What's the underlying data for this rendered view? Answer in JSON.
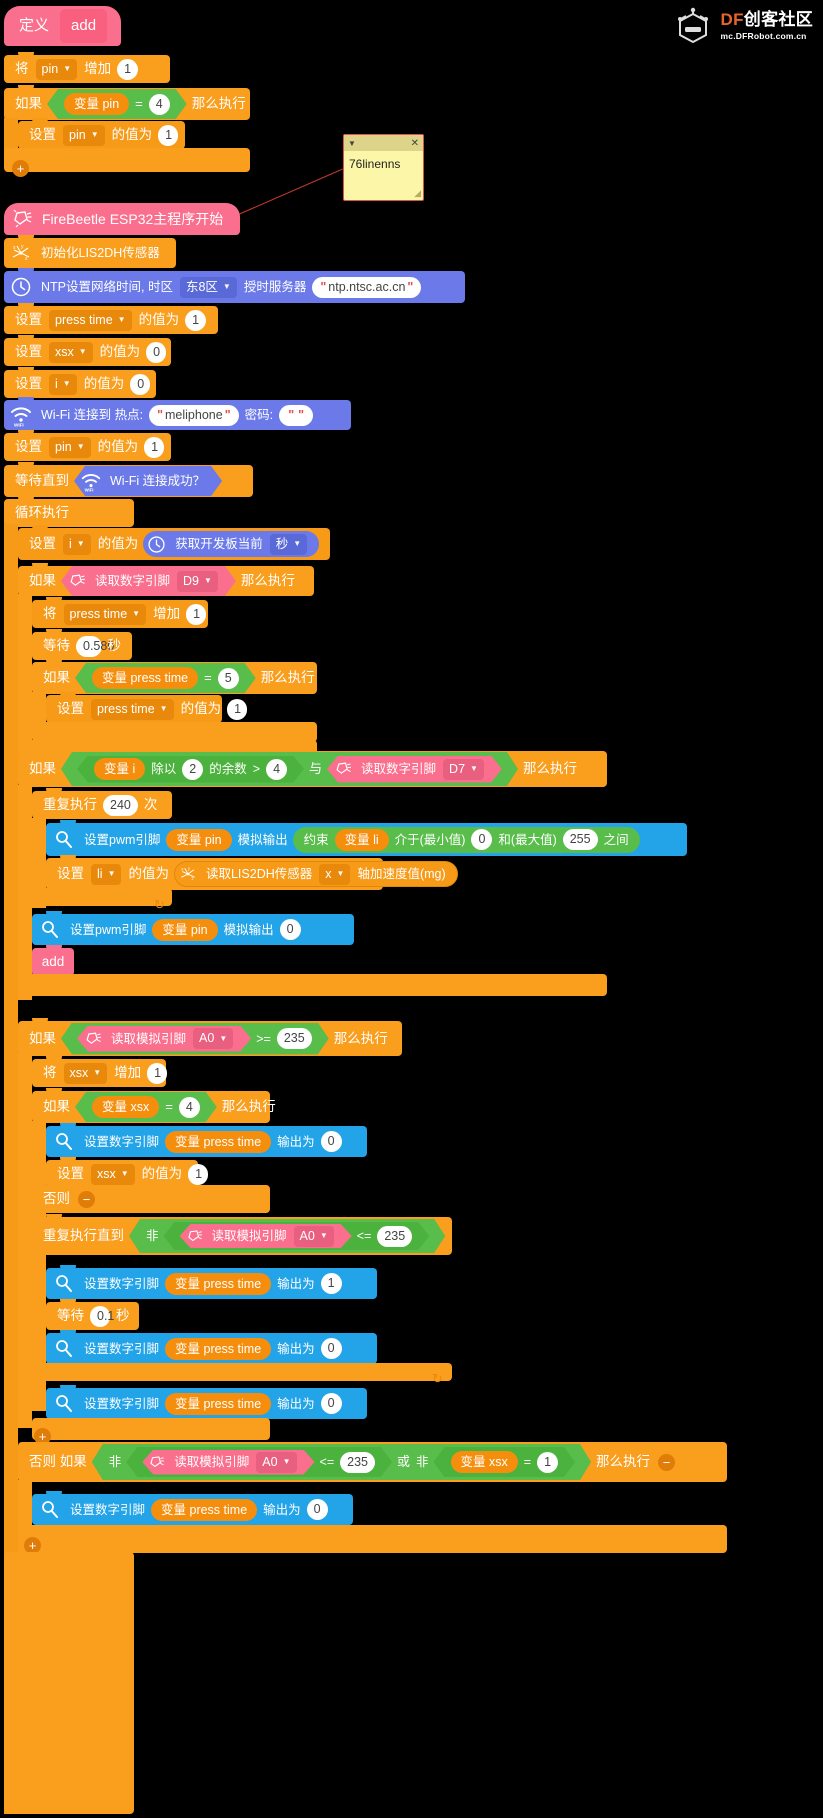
{
  "app": {
    "background": "#000000",
    "brand": {
      "name_df": "DF",
      "name_rest": "创客社区",
      "url": "mc.DFRobot.com.cn",
      "accent": "#e8652a",
      "icon": "dfrobot-robot-head-icon"
    }
  },
  "comment_note": {
    "text": "76linenns",
    "collapse_icon": "triangle-down-icon",
    "close_icon": "close-x-icon",
    "resize_icon": "resize-grip-icon",
    "border_color": "#d9534f",
    "fill_color": "#fcf6a8"
  },
  "palette": {
    "variable_orange": "#fa9e1d",
    "event_pink": "#fa6f8e",
    "network_purple": "#6b7ae8",
    "pin_blue": "#23a3e8",
    "operator_green": "#58bd4a",
    "control_orange": "#f79a18"
  },
  "function_def": {
    "keyword": "定义",
    "name": "add",
    "body": {
      "change_by": {
        "prefix": "将",
        "variable": "pin",
        "verb": "增加",
        "value": "1"
      },
      "if_block": {
        "if": "如果",
        "then": "那么执行",
        "cond": {
          "var_label": "变量 pin",
          "op": "=",
          "value": "4"
        },
        "inner": {
          "set": "设置",
          "variable": "pin",
          "mid": "的值为",
          "value": "1"
        }
      },
      "add_icon": "plus-circle-icon"
    }
  },
  "main_program": {
    "start_block": {
      "label": "FireBeetle ESP32主程序开始",
      "icon": "firebeetle-icon"
    },
    "init_sensor": {
      "label": "初始化LIS2DH传感器",
      "icon": "lis2dh-axes-icon"
    },
    "ntp": {
      "prefix": "NTP设置网络时间, 时区",
      "timezone": "东8区",
      "mid": "授时服务器",
      "server": "ntp.ntsc.ac.cn",
      "icon": "clock-icon"
    },
    "set_press_time": {
      "set": "设置",
      "variable": "press time",
      "mid": "的值为",
      "value": "1"
    },
    "set_xsx": {
      "set": "设置",
      "variable": "xsx",
      "mid": "的值为",
      "value": "0"
    },
    "set_i": {
      "set": "设置",
      "variable": "i",
      "mid": "的值为",
      "value": "0"
    },
    "wifi_connect": {
      "prefix": "Wi-Fi 连接到 热点:",
      "ssid": "meliphone",
      "pwd_label": "密码:",
      "password": "",
      "icon": "wifi-icon"
    },
    "set_pin": {
      "set": "设置",
      "variable": "pin",
      "mid": "的值为",
      "value": "1"
    },
    "wait_until": {
      "prefix": "等待直到",
      "cond": "Wi-Fi 连接成功？",
      "icon": "wifi-icon"
    },
    "loop_label": "循环执行"
  },
  "loop_body": {
    "set_i_seconds": {
      "set": "设置",
      "variable": "i",
      "mid": "的值为",
      "reporter": "获取开发板当前",
      "unit": "秒",
      "icon": "clock-icon"
    },
    "if_d9": {
      "if": "如果",
      "then": "那么执行",
      "cond": {
        "label": "读取数字引脚",
        "pin": "D9",
        "icon": "firebeetle-icon"
      },
      "change_press_time": {
        "prefix": "将",
        "variable": "press time",
        "verb": "增加",
        "value": "1"
      },
      "wait": {
        "prefix": "等待",
        "value": "0.580",
        "unit": "秒"
      },
      "if_press_eq5": {
        "if": "如果",
        "then": "那么执行",
        "cond": {
          "var_label": "变量 press time",
          "op": "=",
          "value": "5"
        },
        "inner": {
          "set": "设置",
          "variable": "press time",
          "mid": "的值为",
          "value": "1"
        }
      }
    },
    "if_mod": {
      "if": "如果",
      "then": "那么执行",
      "left": {
        "var_label": "变量 i",
        "op1": "除以",
        "divisor": "2",
        "op2": "的余数",
        "cmp": ">",
        "value": "4"
      },
      "and": "与",
      "right": {
        "label": "读取数字引脚",
        "pin": "D7",
        "icon": "firebeetle-icon"
      },
      "repeat": {
        "prefix": "重复执行",
        "count": "240",
        "suffix": "次"
      },
      "pwm_constrain": {
        "prefix": "设置pwm引脚",
        "pin_var": "变量 pin",
        "mid": "模拟输出",
        "constrain": "约束",
        "value_var": "变量 li",
        "between": "介于(最小值)",
        "min": "0",
        "and": "和(最大值)",
        "max": "255",
        "suffix": "之间",
        "icon": "pin-magnifier-icon"
      },
      "set_li": {
        "set": "设置",
        "variable": "li",
        "mid": "的值为",
        "reader": "读取LIS2DH传感器",
        "axis": "x",
        "unit": "轴加速度值(mg)",
        "icon": "lis2dh-axes-icon"
      },
      "pwm_off": {
        "prefix": "设置pwm引脚",
        "pin_var": "变量 pin",
        "mid": "模拟输出",
        "value": "0",
        "icon": "pin-magnifier-icon"
      },
      "call_add": "add"
    },
    "if_a0": {
      "if": "如果",
      "then": "那么执行",
      "cond": {
        "label": "读取模拟引脚",
        "pin": "A0",
        "op": ">=",
        "value": "235",
        "icon": "firebeetle-icon"
      },
      "change_xsx": {
        "prefix": "将",
        "variable": "xsx",
        "verb": "增加",
        "value": "1"
      },
      "if_xsx_eq4": {
        "if": "如果",
        "then": "那么执行",
        "cond": {
          "var_label": "变量 xsx",
          "op": "=",
          "value": "4"
        },
        "digital_write": {
          "prefix": "设置数字引脚",
          "pin_var": "变量 press time",
          "mid": "输出为",
          "value": "0",
          "icon": "pin-magnifier-icon"
        },
        "set_xsx": {
          "set": "设置",
          "variable": "xsx",
          "mid": "的值为",
          "value": "1"
        },
        "else_label": "否则",
        "else_minus_icon": "minus-circle-icon",
        "repeat_until": {
          "prefix": "重复执行直到",
          "not": "非",
          "label": "读取模拟引脚",
          "pin": "A0",
          "op": "<=",
          "value": "235",
          "icon": "firebeetle-icon",
          "body": [
            {
              "prefix": "设置数字引脚",
              "pin_var": "变量 press time",
              "mid": "输出为",
              "value": "1",
              "icon": "pin-magnifier-icon"
            },
            {
              "prefix": "等待",
              "value": "0.1",
              "unit": "秒"
            },
            {
              "prefix": "设置数字引脚",
              "pin_var": "变量 press time",
              "mid": "输出为",
              "value": "0",
              "icon": "pin-magnifier-icon"
            }
          ]
        },
        "after_digital_write": {
          "prefix": "设置数字引脚",
          "pin_var": "变量 press time",
          "mid": "输出为",
          "value": "0",
          "icon": "pin-magnifier-icon"
        }
      }
    },
    "else_if_block": {
      "label": "否则 如果",
      "then": "那么执行",
      "minus_icon": "minus-circle-icon",
      "not1": "非",
      "cond1": {
        "label": "读取模拟引脚",
        "pin": "A0",
        "op": "<=",
        "value": "235",
        "icon": "firebeetle-icon"
      },
      "or": "或",
      "not2": "非",
      "cond2": {
        "var_label": "变量 xsx",
        "op": "=",
        "value": "1"
      },
      "body": {
        "prefix": "设置数字引脚",
        "pin_var": "变量 press time",
        "mid": "输出为",
        "value": "0",
        "icon": "pin-magnifier-icon"
      },
      "plus_icon": "plus-circle-icon"
    }
  }
}
